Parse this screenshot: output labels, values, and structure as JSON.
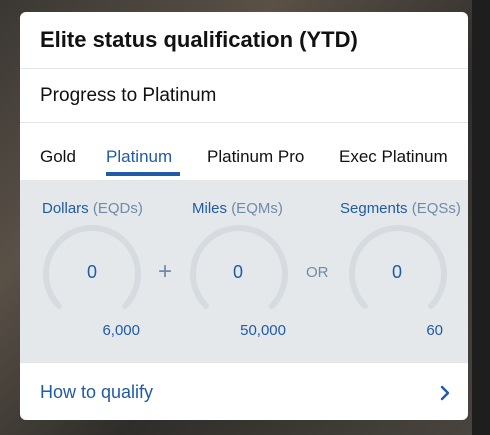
{
  "card": {
    "title": "Elite status qualification (YTD)",
    "subtitle": "Progress to Platinum"
  },
  "tabs": [
    {
      "label": "Gold",
      "active": false
    },
    {
      "label": "Platinum",
      "active": true
    },
    {
      "label": "Platinum Pro",
      "active": false
    },
    {
      "label": "Exec Platinum",
      "active": false
    }
  ],
  "metrics": [
    {
      "label": "Dollars",
      "unit": "(EQDs)",
      "value": "0",
      "target": "6,000",
      "progress": 0
    },
    {
      "label": "Miles",
      "unit": "(EQMs)",
      "value": "0",
      "target": "50,000",
      "progress": 0
    },
    {
      "label": "Segments",
      "unit": "(EQSs)",
      "value": "0",
      "target": "60",
      "progress": 0
    }
  ],
  "operators": {
    "plus": "+",
    "or": "OR"
  },
  "footer": {
    "link_label": "How to qualify"
  },
  "colors": {
    "accent": "#1f5ba8",
    "panel_bg": "#e5e8eb",
    "gauge_track": "#d6dbe0"
  },
  "icons": {
    "footer_chevron": "chevron-right-icon"
  }
}
